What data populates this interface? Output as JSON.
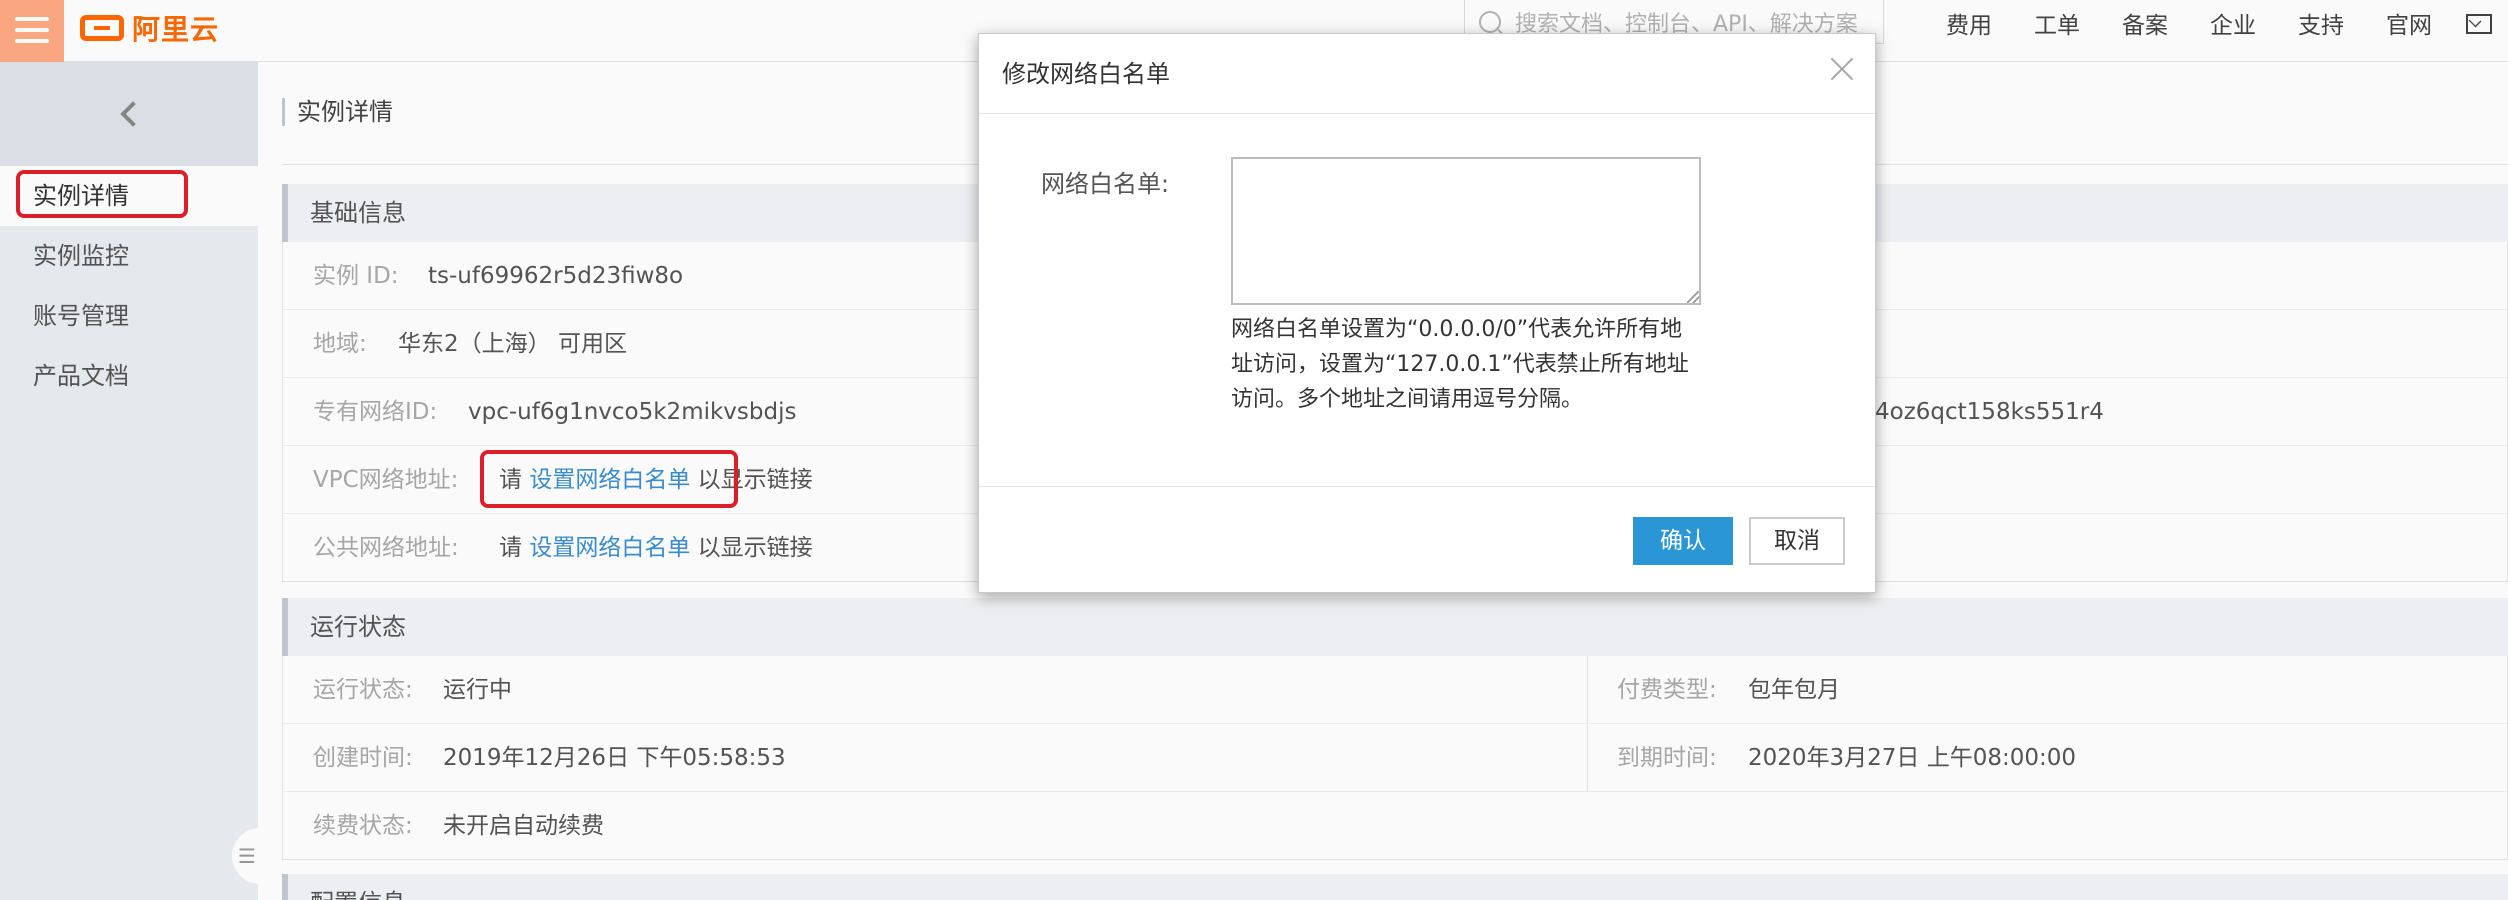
{
  "header": {
    "logo_text": "阿里云",
    "search_placeholder": "搜索文档、控制台、API、解决方案",
    "nav": [
      "费用",
      "工单",
      "备案",
      "企业",
      "支持",
      "官网"
    ]
  },
  "sidebar": {
    "items": [
      {
        "label": "实例详情"
      },
      {
        "label": "实例监控"
      },
      {
        "label": "账号管理"
      },
      {
        "label": "产品文档"
      }
    ]
  },
  "main": {
    "page_title": "实例详情",
    "basic": {
      "title": "基础信息",
      "instance_id_label": "实例 ID:",
      "instance_id": "ts-uf69962r5d23fiw8o",
      "region_label": "地域:",
      "region": "华东2（上海） 可用区",
      "vpc_id_label": "专有网络ID:",
      "vpc_id": "vpc-uf6g1nvco5k2mikvsbdjs",
      "vswitch_tail": "4oz6qct158ks551r4",
      "vpc_addr_label": "VPC网络地址:",
      "public_addr_label": "公共网络地址:",
      "addr_prefix": "请",
      "addr_link": "设置网络白名单",
      "addr_suffix": "以显示链接"
    },
    "run": {
      "title": "运行状态",
      "status_label": "运行状态:",
      "status": "运行中",
      "pay_label": "付费类型:",
      "pay": "包年包月",
      "created_label": "创建时间:",
      "created": "2019年12月26日 下午05:58:53",
      "expire_label": "到期时间:",
      "expire": "2020年3月27日 上午08:00:00",
      "renew_label": "续费状态:",
      "renew": "未开启自动续费"
    },
    "config_title": "配置信息"
  },
  "modal": {
    "title": "修改网络白名单",
    "field_label": "网络白名单:",
    "field_value": "",
    "hint": "网络白名单设置为“0.0.0.0/0”代表允许所有地址访问，设置为“127.0.0.1”代表禁止所有地址访问。多个地址之间请用逗号分隔。",
    "confirm": "确认",
    "cancel": "取消"
  },
  "colors": {
    "accent": "#ff6a00",
    "primary_button": "#2b96d6",
    "link": "#3c8ed1",
    "highlight": "#e0202a"
  }
}
